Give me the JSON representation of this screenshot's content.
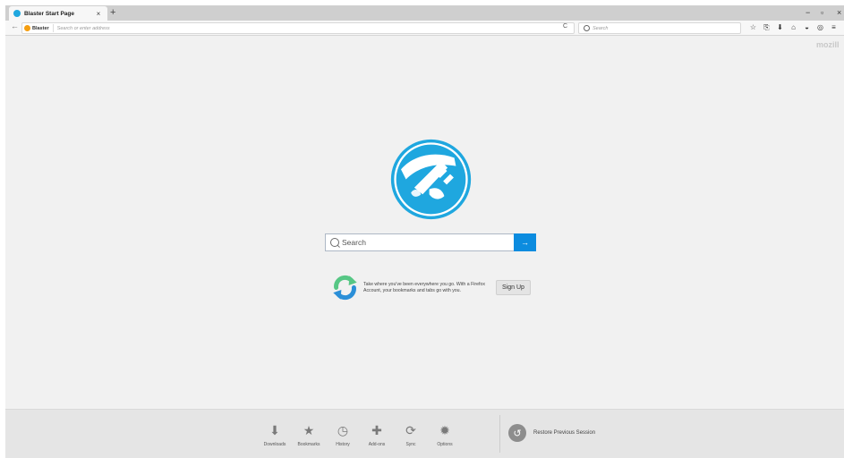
{
  "tab": {
    "title": "Blaster Start Page",
    "close": "×",
    "new_tab": "+"
  },
  "window_controls": {
    "minimize": "−",
    "restore": "▫",
    "close": "×"
  },
  "navbar": {
    "back": "←",
    "identity": "Blaster",
    "url_placeholder": "Search or enter address",
    "reload": "C",
    "search_placeholder": "Search",
    "toolbar_icons": [
      "star-icon",
      "clipboard-icon",
      "download-icon",
      "home-icon",
      "pocket-icon",
      "chat-icon",
      "menu-icon"
    ],
    "toolbar_glyphs": [
      "☆",
      "⎘",
      "⬇",
      "⌂",
      "◒",
      "◎",
      "≡"
    ]
  },
  "content": {
    "mozilla_link": "mozill",
    "search_placeholder": "Search",
    "search_go": "→",
    "sync_text": "Take where you've been everywhere you go. With a Firefox Account, your bookmarks and tabs go with you.",
    "signup": "Sign Up"
  },
  "launcher": {
    "items": [
      {
        "label": "Downloads",
        "glyph": "⬇",
        "icon": "downloads-icon"
      },
      {
        "label": "Bookmarks",
        "glyph": "★",
        "icon": "bookmarks-icon"
      },
      {
        "label": "History",
        "glyph": "◷",
        "icon": "history-icon"
      },
      {
        "label": "Add-ons",
        "glyph": "✚",
        "icon": "addons-icon"
      },
      {
        "label": "Sync",
        "glyph": "⟳",
        "icon": "sync-icon"
      },
      {
        "label": "Options",
        "glyph": "✹",
        "icon": "options-icon"
      }
    ],
    "restore_label": "Restore Previous Session",
    "restore_glyph": "↺"
  },
  "colors": {
    "accent": "#0c8cdf",
    "logo_blue": "#1fa7df",
    "sync_green": "#57c785",
    "sync_blue": "#2b8fd8"
  }
}
